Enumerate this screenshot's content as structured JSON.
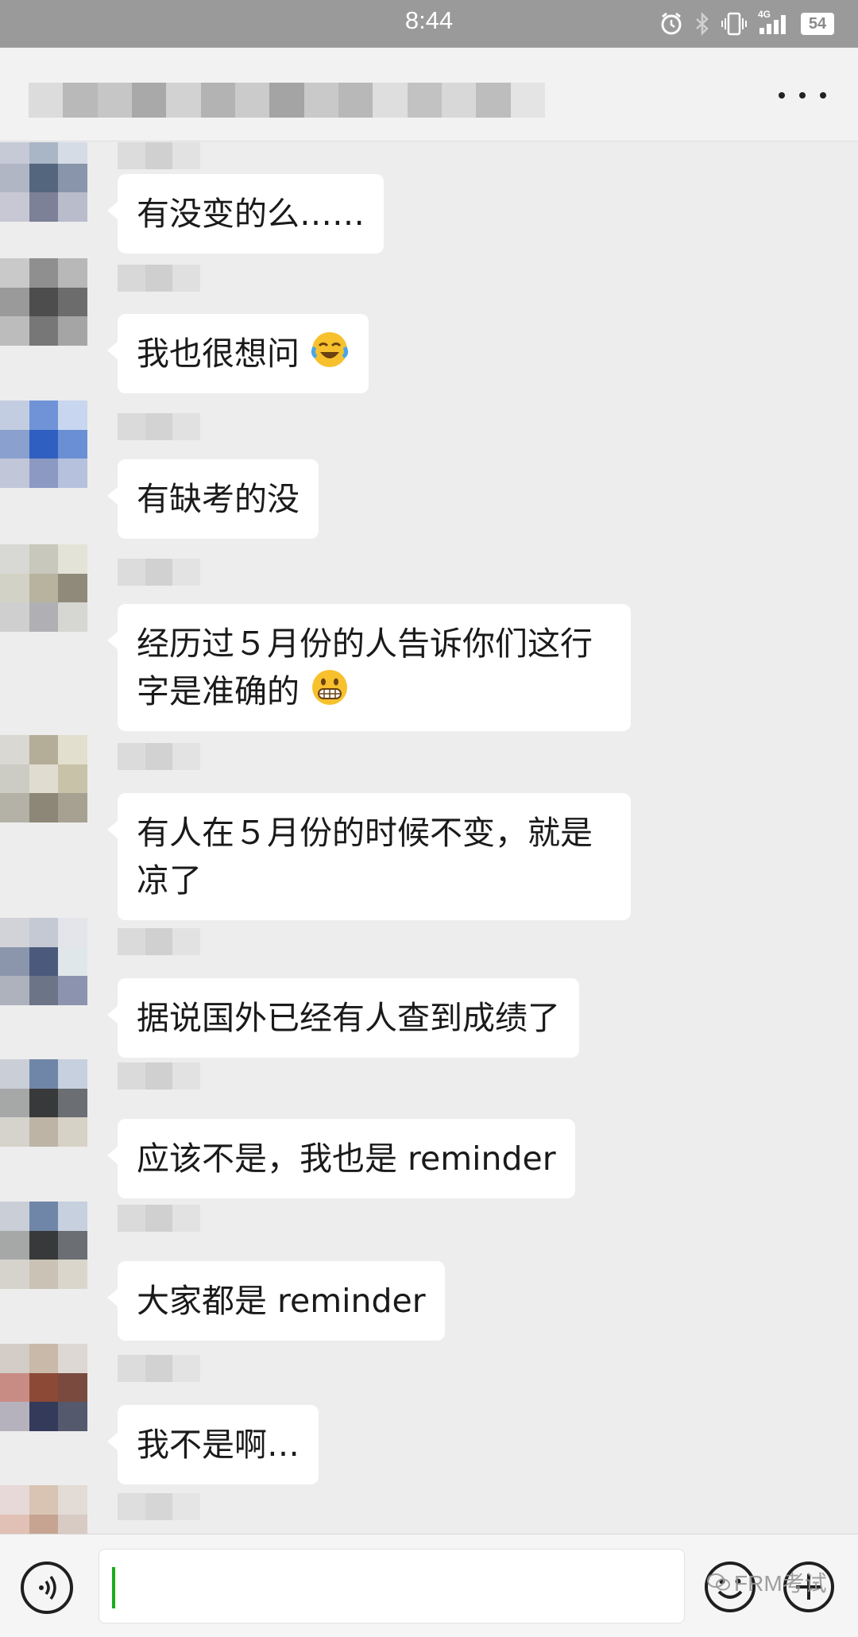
{
  "status_bar": {
    "time": "8:44",
    "network": "4G",
    "battery": "54",
    "icons": [
      "alarm-icon",
      "bluetooth-icon",
      "vibrate-icon",
      "signal-icon",
      "battery-icon"
    ]
  },
  "header": {
    "title_blurred": true,
    "menu_icon": "more-icon"
  },
  "messages": [
    {
      "text": "有没变的么……"
    },
    {
      "text": "我也很想问",
      "emoji": "crying-laughing-emoji"
    },
    {
      "text": "有缺考的没"
    },
    {
      "text": "经历过５月份的人告诉你们这行",
      "text2": "字是准确的",
      "emoji": "grinning-emoji"
    },
    {
      "text": "有人在５月份的时候不变，就是",
      "text2": "凉了"
    },
    {
      "text": "据说国外已经有人查到成绩了"
    },
    {
      "text": "应该不是，我也是 reminder"
    },
    {
      "text": "大家都是 reminder"
    },
    {
      "text": "我不是啊…"
    }
  ],
  "input_bar": {
    "voice_icon": "voice-icon",
    "emoji_icon": "emoji-icon",
    "add_icon": "plus-icon",
    "input_value": ""
  },
  "watermark": {
    "text": "FRM考试"
  },
  "colors": {
    "background": "#ededed",
    "bubble": "#ffffff",
    "status_bar": "#9a9a9a",
    "cursor": "#1aad19"
  }
}
